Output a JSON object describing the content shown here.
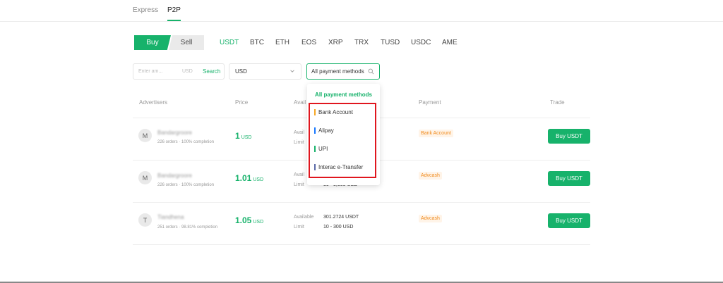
{
  "top_tabs": {
    "express": "Express",
    "p2p": "P2P"
  },
  "trade_toggle": {
    "buy": "Buy",
    "sell": "Sell"
  },
  "coins": [
    "USDT",
    "BTC",
    "ETH",
    "EOS",
    "XRP",
    "TRX",
    "TUSD",
    "USDC",
    "AME"
  ],
  "filters": {
    "amount_placeholder": "Enter am...",
    "amount_unit": "USD",
    "search_label": "Search",
    "currency": "USD",
    "payment": "All payment methods"
  },
  "table_headers": {
    "advertisers": "Advertisers",
    "price": "Price",
    "available": "Avail",
    "payment": "Payment",
    "trade": "Trade"
  },
  "rows": [
    {
      "avatar": "M",
      "name": "Bandargroore",
      "stats": "226 orders · 100% completion",
      "price": "1",
      "currency": "USD",
      "available_label": "Avail",
      "available_value": "",
      "limit_label": "Limit",
      "limit_value": "",
      "payment": "Bank Account",
      "trade": "Buy USDT"
    },
    {
      "avatar": "M",
      "name": "Bandargroore",
      "stats": "226 orders · 100% completion",
      "price": "1.01",
      "currency": "USD",
      "available_label": "Avail",
      "available_value": "",
      "limit_label": "Limit",
      "limit_value": "30 - 5,000 USD",
      "payment": "Advcash",
      "trade": "Buy USDT"
    },
    {
      "avatar": "T",
      "name": "Tiandhena",
      "stats": "251 orders · 98.81% completion",
      "price": "1.05",
      "currency": "USD",
      "available_label": "Available",
      "available_value": "301.2724 USDT",
      "limit_label": "Limit",
      "limit_value": "10 - 300 USD",
      "payment": "Advcash",
      "trade": "Buy USDT"
    }
  ],
  "dropdown": {
    "title": "All payment methods",
    "items": [
      {
        "label": "Bank Account",
        "color": "#f5a623"
      },
      {
        "label": "Alipay",
        "color": "#1677ff"
      },
      {
        "label": "UPI",
        "color": "#17b26b"
      },
      {
        "label": "Interac e-Transfer",
        "color": "#5b6aa8"
      }
    ]
  },
  "colors": {
    "accent": "#17b26b",
    "highlight": "#e0161e",
    "badge_text": "#f08a1c"
  }
}
